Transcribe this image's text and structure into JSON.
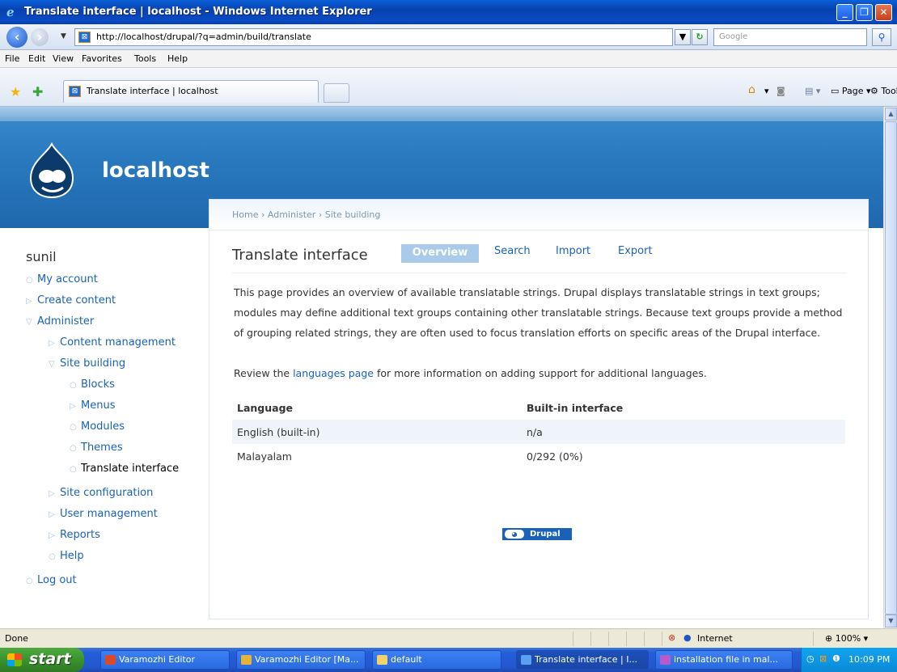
{
  "window": {
    "title": "Translate interface | localhost - Windows Internet Explorer",
    "min": "_",
    "max": "❐",
    "close": "✕"
  },
  "address": {
    "url": "http://localhost/drupal/?q=admin/build/translate",
    "search_placeholder": "Google",
    "dropdown_glyph": "▼",
    "refresh_glyph": "↻",
    "stop_glyph": "✕",
    "search_glyph": "⚲"
  },
  "menu": [
    "File",
    "Edit",
    "View",
    "Favorites",
    "Tools",
    "Help"
  ],
  "tab": {
    "label": "Translate interface | localhost"
  },
  "commandbar": {
    "page": "Page",
    "tools": "Tools"
  },
  "site": {
    "name": "localhost"
  },
  "breadcrumb": "Home › Administer › Site building",
  "page": {
    "title": "Translate interface",
    "tabs": [
      {
        "label": "Overview"
      },
      {
        "label": "Search"
      },
      {
        "label": "Import"
      },
      {
        "label": "Export"
      }
    ],
    "description": "This page provides an overview of available translatable strings. Drupal displays translatable strings in text groups; modules may define additional text groups containing other translatable strings. Because text groups provide a method of grouping related strings, they are often used to focus translation efforts on specific areas of the Drupal interface.",
    "review_prefix": "Review the ",
    "review_link": "languages page",
    "review_suffix": " for more information on adding support for additional languages.",
    "table": {
      "headers": [
        "Language",
        "Built-in interface"
      ],
      "rows": [
        [
          "English (built-in)",
          "n/a"
        ],
        [
          "Malayalam",
          "0/292 (0%)"
        ]
      ]
    },
    "powered_by": "Drupal"
  },
  "sidebar": {
    "user": "sunil",
    "items": [
      {
        "label": "My account"
      },
      {
        "label": "Create content"
      },
      {
        "label": "Administer"
      },
      {
        "label": "Content management"
      },
      {
        "label": "Site building"
      },
      {
        "label": "Blocks"
      },
      {
        "label": "Menus"
      },
      {
        "label": "Modules"
      },
      {
        "label": "Themes"
      },
      {
        "label": "Translate interface"
      },
      {
        "label": "Site configuration"
      },
      {
        "label": "User management"
      },
      {
        "label": "Reports"
      },
      {
        "label": "Help"
      },
      {
        "label": "Log out"
      }
    ]
  },
  "status": {
    "text": "Done",
    "zone": "Internet",
    "zoom": "100%"
  },
  "taskbar": {
    "start": "start",
    "tasks": [
      {
        "label": "Varamozhi Editor"
      },
      {
        "label": "Varamozhi Editor [Ma..."
      },
      {
        "label": "default"
      },
      {
        "label": "Translate interface | I..."
      },
      {
        "label": "installation file in mal..."
      }
    ],
    "clock": "10:09 PM"
  },
  "colors": {
    "link": "#1a62b8",
    "header_blue": "#2a7ac0",
    "active_tab": "#a9cbe9",
    "row_stripe": "#eef4fa"
  }
}
